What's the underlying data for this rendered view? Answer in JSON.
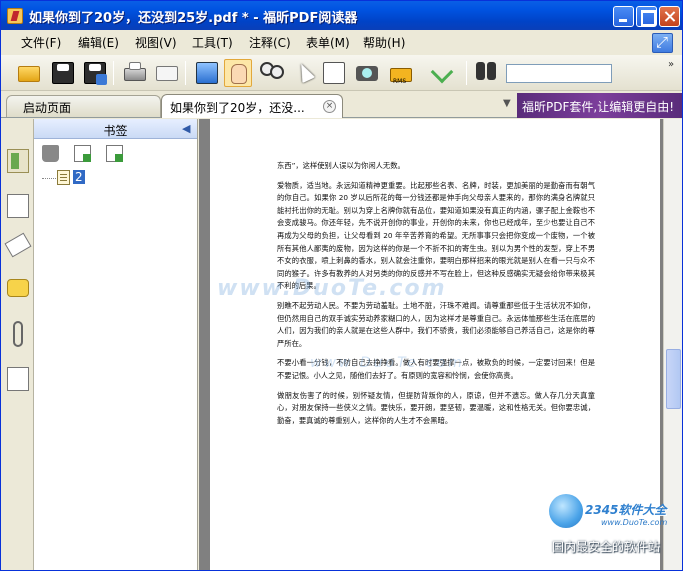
{
  "window": {
    "title": "如果你到了20岁，还没到25岁.pdf * - 福昕PDF阅读器"
  },
  "menu": [
    {
      "label": "文件(F)"
    },
    {
      "label": "编辑(E)"
    },
    {
      "label": "视图(V)"
    },
    {
      "label": "工具(T)"
    },
    {
      "label": "注释(C)"
    },
    {
      "label": "表单(M)"
    },
    {
      "label": "帮助(H)"
    }
  ],
  "toolbar": {
    "search_value": "",
    "rms_label": "RMS"
  },
  "tabs": {
    "start": "启动页面",
    "doc": "如果你到了20岁，还没...",
    "close": "×"
  },
  "ad": "福昕PDF套件,让编辑更自由!",
  "panel": {
    "title": "书签",
    "bookmark_label": "2"
  },
  "document": {
    "paragraphs": [
      "东西”，这样使别人误以为你闲人无数。",
      "爱物质，适当地。永远知道精神更重要。比起那些名表、名牌，时装，更加美丽的是勤奋而有朝气的你自己。如果你 20 岁以后所花的每一分钱还都是伸手向父母亲人要来的，那你的满身名牌就只能衬托出你的无耻。别以为穿上名牌你就有品位，要知道如果没有真正的内涵，骡子配上金鞍也不会变成骏马。你还年轻，先不说开创你的事业，开创你的未来，你也已经成年，至少也要让自己不再成为父母的负担，让父母看到 20 年辛苦养育的希望。无所事事只会把你变成一个废物，一个被所有其他人鄙夷的废物，因为这样的你是一个不折不扣的寄生虫。别以为男个性的发型，穿上不男不女的衣服，喷上刺鼻的香水，别人就会注重你，要明白那样招来的眼光就是别人在看一只与众不同的猴子。许多有教养的人对另类的你的反感并不写在脸上，但这种反感确实无疑会给你带来极其不利的后果。",
      "别瞧不起劳动人民。不要为劳动羞耻。土地不脏，汗珠不难闻。请尊重那些低于生活状况不如你，但仍然用自己的双手诚实劳动养家糊口的人，因为这样才是尊重自己。永远体恤那些生活在底层的人们，因为我们的亲人就是在这些人群中，我们不骄贵，我们必须能够自己养活自己，这是你的尊严所在。",
      "不要小看一分钱，不防自己去挣挣看。做人有时要强撑一点，被欺负的时候，一定要讨回来！但是不要记恨。小人之见，随他们去好了。有原则的宽容和怜悯，会使你高贵。",
      "做朋友伤害了的时候，别怀疑友情，但提防背叛你的人，原谅，但并不遗忘。做人存几分天真童心，对朋友保持一些侠义之情。要快乐，要开朗，要坚韧，要温暖，这和性格无关。但你要忠诚，勤奋，要真诚的尊重别人，这样你的人生才不会黑暗。"
    ]
  },
  "watermark": {
    "main": "www.DuoTe.com",
    "secondary": "www.DuoTe.com"
  },
  "corner_logo": {
    "brand": "2345软件大全",
    "url": "www.DuoTe.com",
    "slogan": "国内最安全的软件站"
  }
}
